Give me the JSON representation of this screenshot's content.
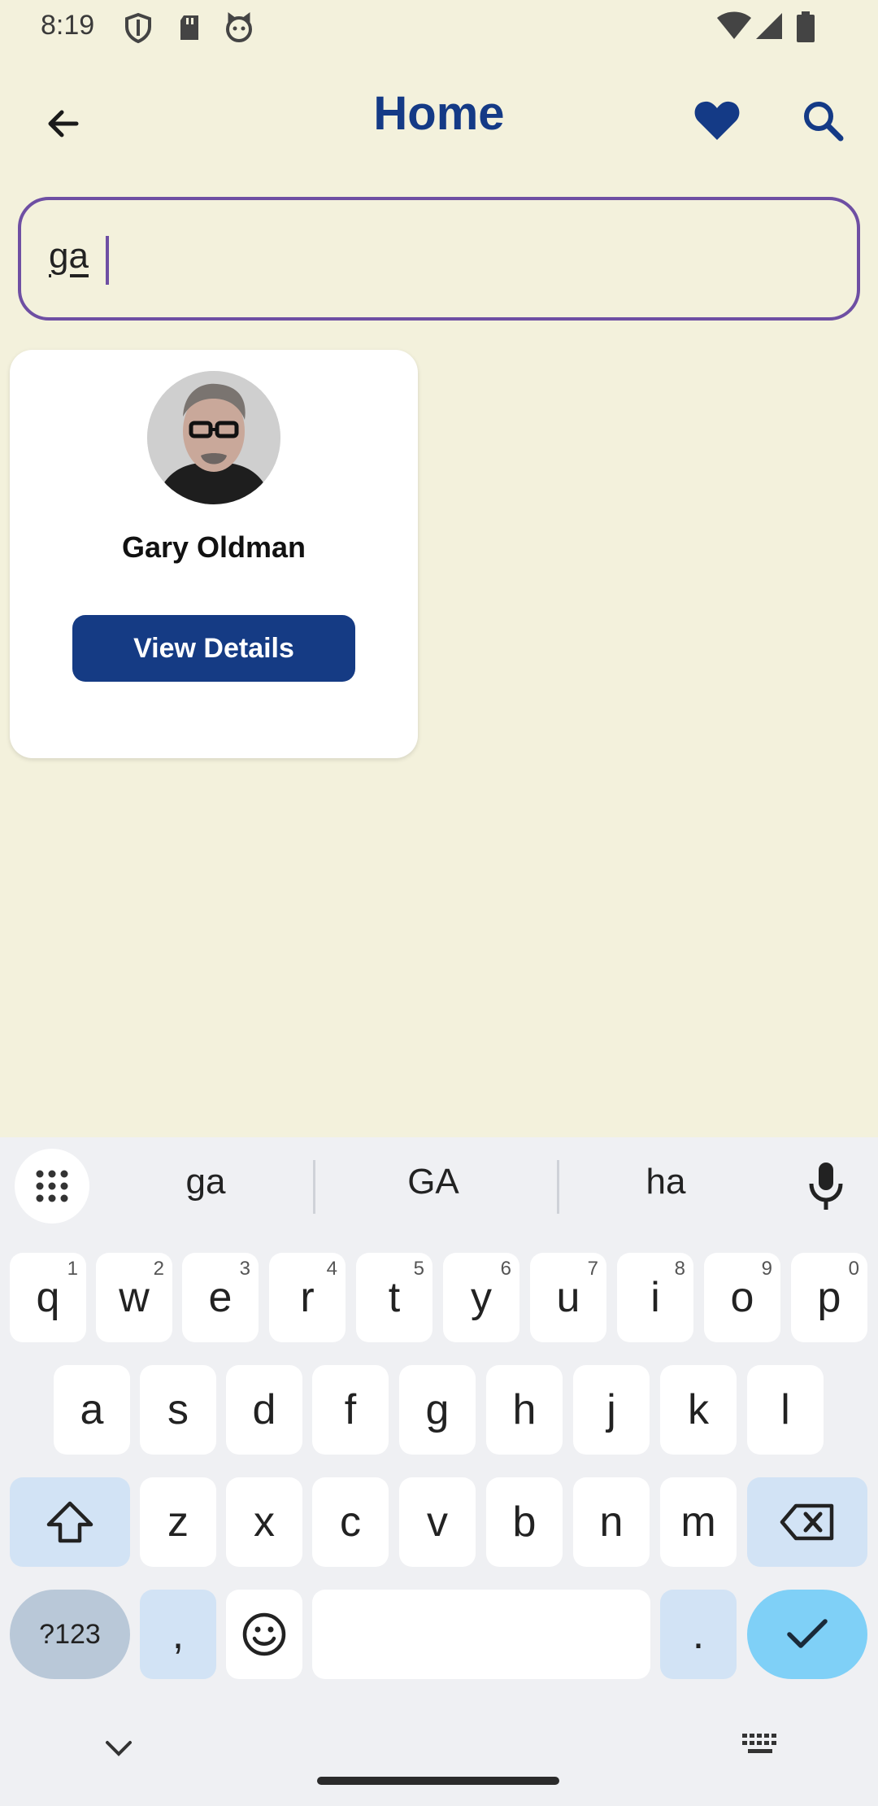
{
  "status_bar": {
    "time": "8:19"
  },
  "app_bar": {
    "title": "Home",
    "back_icon": "arrow-back-icon",
    "favorite_icon": "heart-icon",
    "search_icon": "search-icon"
  },
  "search": {
    "value": "ga"
  },
  "results": [
    {
      "name": "Gary Oldman",
      "button_label": "View Details"
    }
  ],
  "keyboard": {
    "suggestions": [
      "ga",
      "GA",
      "ha"
    ],
    "row1": [
      {
        "label": "q",
        "hint": "1"
      },
      {
        "label": "w",
        "hint": "2"
      },
      {
        "label": "e",
        "hint": "3"
      },
      {
        "label": "r",
        "hint": "4"
      },
      {
        "label": "t",
        "hint": "5"
      },
      {
        "label": "y",
        "hint": "6"
      },
      {
        "label": "u",
        "hint": "7"
      },
      {
        "label": "i",
        "hint": "8"
      },
      {
        "label": "o",
        "hint": "9"
      },
      {
        "label": "p",
        "hint": "0"
      }
    ],
    "row2": [
      "a",
      "s",
      "d",
      "f",
      "g",
      "h",
      "j",
      "k",
      "l"
    ],
    "row3": [
      "z",
      "x",
      "c",
      "v",
      "b",
      "n",
      "m"
    ],
    "symbols_label": "?123",
    "comma_label": ",",
    "period_label": "."
  },
  "colors": {
    "background": "#f3f1dc",
    "primary": "#143a86",
    "input_border": "#6e4fa3",
    "keyboard_bg": "#eff0f3",
    "enter_key": "#7fd0f7"
  }
}
